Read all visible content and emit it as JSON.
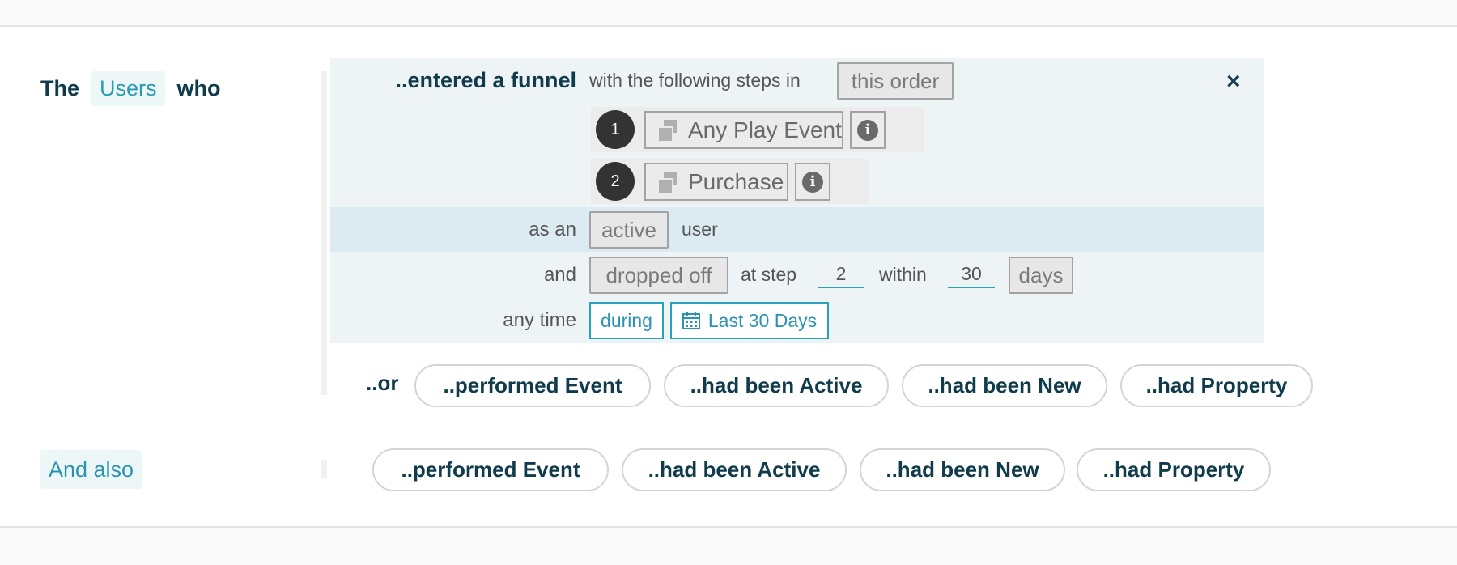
{
  "lead": {
    "the": "The",
    "entity": "Users",
    "who": "who"
  },
  "rule": {
    "title": "..entered a funnel",
    "with_steps": "with the following steps in",
    "order_option": "this order",
    "close_label": "×",
    "steps": [
      {
        "number": "1",
        "event": "Any Play Event",
        "info_icon": "i"
      },
      {
        "number": "2",
        "event": "Purchase",
        "info_icon": "i"
      }
    ],
    "as_an": "as an",
    "user_state": "active",
    "user_word": "user",
    "and": "and",
    "funnel_action": "dropped off",
    "at_step": "at step",
    "step_value": "2",
    "within": "within",
    "within_value": "30",
    "unit": "days",
    "any_time": "any time",
    "time_mode": "during",
    "date_range": "Last 30 Days"
  },
  "or_row": {
    "label": "..or",
    "options": [
      "..performed Event",
      "..had been Active",
      "..had been New",
      "..had Property"
    ]
  },
  "and_also": {
    "label": "And also",
    "options": [
      "..performed Event",
      "..had been Active",
      "..had been New",
      "..had Property"
    ]
  },
  "colors": {
    "accent": "#2aa0bf",
    "title": "#0f3b4b",
    "rule_bg": "#eef4f6",
    "band_bg": "#dcebf1"
  }
}
